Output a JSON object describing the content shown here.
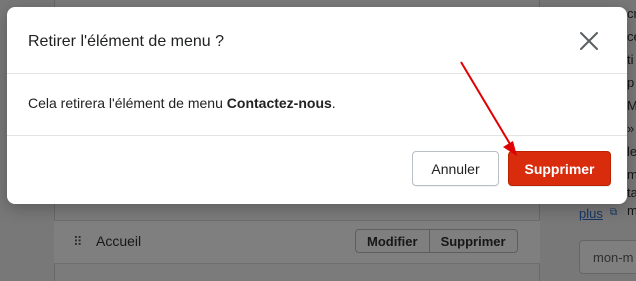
{
  "background": {
    "drag_glyph": "⠿",
    "row_label": "Accueil",
    "row_buttons": [
      "Modifier",
      "Supprimer"
    ],
    "side_fragments": [
      "cr",
      "ce",
      "ti",
      "p",
      "Me",
      "»",
      "le",
      "m",
      "ta",
      "m"
    ],
    "link_label": "plus",
    "input_value": "mon-m"
  },
  "modal": {
    "title": "Retirer l'élément de menu ?",
    "close_icon": "close-icon",
    "body_prefix": "Cela retirera l'élément de menu ",
    "body_item": "Contactez-nous",
    "body_suffix": ".",
    "cancel_label": "Annuler",
    "delete_label": "Supprimer"
  },
  "annotation": {
    "arrow_color": "#e00000"
  },
  "colors": {
    "destructive": "#d82c0d",
    "link": "#2c6ecb"
  }
}
